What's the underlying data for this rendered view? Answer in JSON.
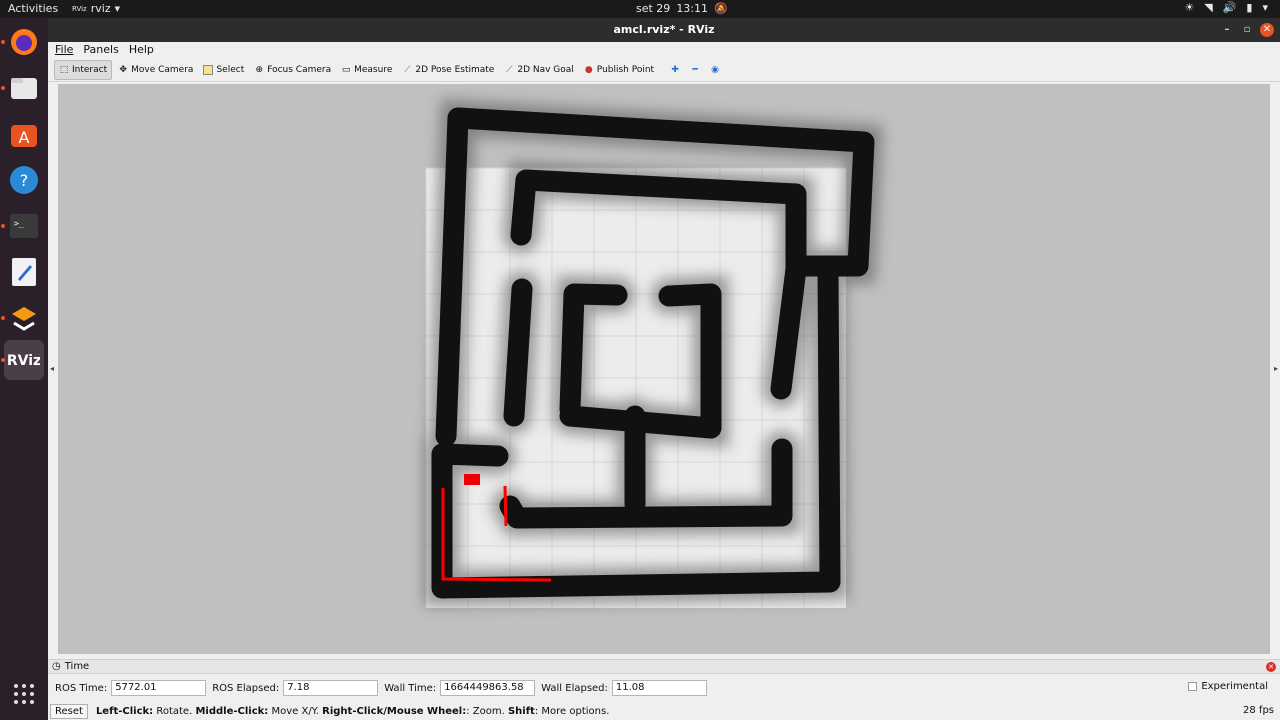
{
  "topbar": {
    "activities": "Activities",
    "app_name": "rviz",
    "date": "set 29",
    "time": "13:11"
  },
  "window": {
    "title": "amcl.rviz* - RViz"
  },
  "menu": [
    "File",
    "Panels",
    "Help"
  ],
  "tools": [
    {
      "label": "Interact",
      "icon": "cursor-icon"
    },
    {
      "label": "Move Camera",
      "icon": "move-camera-icon"
    },
    {
      "label": "Select",
      "icon": "select-icon"
    },
    {
      "label": "Focus Camera",
      "icon": "focus-camera-icon"
    },
    {
      "label": "Measure",
      "icon": "ruler-icon"
    },
    {
      "label": "2D Pose Estimate",
      "icon": "pose-arrow-icon"
    },
    {
      "label": "2D Nav Goal",
      "icon": "nav-goal-arrow-icon"
    },
    {
      "label": "Publish Point",
      "icon": "map-pin-icon"
    }
  ],
  "time_panel": {
    "title": "Time",
    "ros_time_label": "ROS Time:",
    "ros_time": "5772.01",
    "ros_elapsed_label": "ROS Elapsed:",
    "ros_elapsed": "7.18",
    "wall_time_label": "Wall Time:",
    "wall_time": "1664449863.58",
    "wall_elapsed_label": "Wall Elapsed:",
    "wall_elapsed": "11.08",
    "experimental": "Experimental"
  },
  "status": {
    "reset": "Reset",
    "left_click": "Left-Click:",
    "left_click_text": "Rotate.",
    "middle_click": "Middle-Click:",
    "middle_click_text": "Move X/Y.",
    "right_click": "Right-Click/Mouse Wheel:",
    "right_click_text": ": Zoom.",
    "shift": "Shift",
    "shift_text": ": More options.",
    "fps": "28 fps"
  },
  "colors": {
    "accent": "#e95420",
    "laser": "#ff0000",
    "wall": "#111111",
    "background": "#c0c0c0"
  }
}
